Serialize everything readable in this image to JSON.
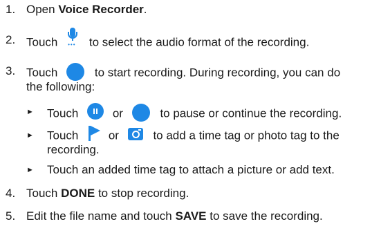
{
  "steps": [
    {
      "num": "1.",
      "pre": "Open ",
      "bold": "Voice Recorder",
      "post": "."
    },
    {
      "num": "2.",
      "pre": "Touch",
      "post": "to select the audio format of the recording.",
      "icon": "microphone-icon"
    },
    {
      "num": "3.",
      "pre": "Touch",
      "post": "to start recording. During recording, you can do",
      "cont": "the following:",
      "icon": "record-icon"
    },
    {
      "num": "4.",
      "pre": "Touch ",
      "bold": "DONE",
      "post": " to stop recording."
    },
    {
      "num": "5.",
      "pre": "Edit the file name and touch ",
      "bold": "SAVE",
      "post": " to save the recording."
    }
  ],
  "sub": [
    {
      "arrow": "►",
      "pre": "Touch",
      "mid": "or",
      "post": "to pause or continue the recording.",
      "icon1": "pause-icon",
      "icon2": "record-icon"
    },
    {
      "arrow": "►",
      "pre": "Touch",
      "mid": "or",
      "post": "to add a time tag or photo tag to the",
      "cont": "recording.",
      "icon1": "flag-icon",
      "icon2": "camera-icon"
    },
    {
      "arrow": "►",
      "text": "Touch an added time tag to attach a picture or add text."
    }
  ],
  "colors": {
    "accent": "#1e88e5",
    "text": "#1a1a1a"
  }
}
